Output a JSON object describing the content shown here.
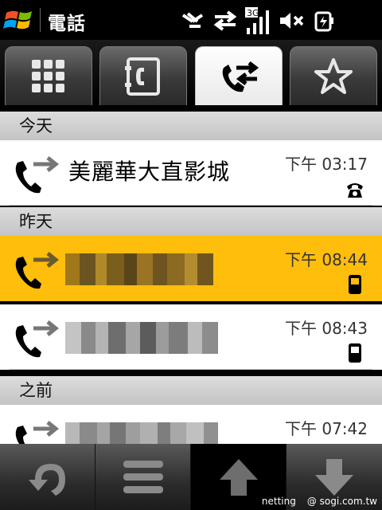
{
  "app": {
    "title": "電話"
  },
  "status_bar": {
    "icons": [
      "sync-off-icon",
      "data-transfer-icon",
      "3g-signal-icon",
      "volume-muted-icon",
      "battery-charging-icon"
    ],
    "network": "3G"
  },
  "tabs": [
    {
      "name": "keypad",
      "icon": "keypad-icon",
      "active": false
    },
    {
      "name": "contacts",
      "icon": "contacts-book-icon",
      "active": false
    },
    {
      "name": "call-history",
      "icon": "call-history-icon",
      "active": true
    },
    {
      "name": "favorites",
      "icon": "star-icon",
      "active": false
    }
  ],
  "sections": [
    {
      "label": "今天",
      "calls": [
        {
          "name": "美麗華大直影城",
          "time": "下午 03:17",
          "type": "home-phone-icon",
          "selected": false
        }
      ]
    },
    {
      "label": "昨天",
      "calls": [
        {
          "name": "",
          "time": "下午 08:44",
          "type": "mobile-phone-icon",
          "selected": true
        },
        {
          "name": "",
          "time": "下午 08:43",
          "type": "mobile-phone-icon",
          "selected": false
        }
      ]
    },
    {
      "label": "之前",
      "calls": [
        {
          "name": "",
          "time": "下午 07:42",
          "type": "mobile-phone-icon",
          "selected": false
        }
      ]
    }
  ],
  "bottom_bar": {
    "buttons": [
      "back-icon",
      "menu-icon",
      "scroll-up-icon",
      "scroll-down-icon"
    ]
  },
  "watermark": {
    "left": "netting",
    "right": "@ sogi.com.tw"
  },
  "colors": {
    "selected_row": "#ffbd0c",
    "section_header": "#cfcfcf",
    "background": "#000000"
  }
}
